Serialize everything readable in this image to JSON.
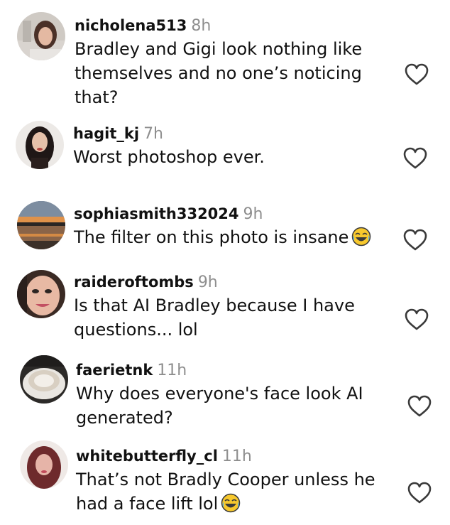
{
  "comments": [
    {
      "username": "nicholena513",
      "time": "8h",
      "lines": [
        "Bradley and Gigi look nothing like",
        "themselves and no one’s noticing",
        "that?"
      ],
      "avatar_icon": "profile-photo-woman-icon",
      "like_icon": "heart-outline-icon"
    },
    {
      "username": "hagit_kj",
      "time": "7h",
      "lines": [
        "Worst photoshop ever."
      ],
      "avatar_icon": "profile-photo-woman-dark-hair-icon",
      "like_icon": "heart-outline-icon"
    },
    {
      "username": "sophiasmith332024",
      "time": "9h",
      "lines": [
        "The filter on this photo is insane"
      ],
      "emoji": "face-with-tears-of-joy-emoji",
      "avatar_icon": "profile-photo-sunset-icon",
      "like_icon": "heart-outline-icon"
    },
    {
      "username": "raideroftombs",
      "time": "9h",
      "lines": [
        "Is that AI Bradley because I have",
        "questions... lol"
      ],
      "avatar_icon": "profile-photo-face-closeup-icon",
      "like_icon": "heart-outline-icon"
    },
    {
      "username": "faerietnk",
      "time": "11h",
      "lines": [
        "Why does everyone's face look AI",
        "generated?"
      ],
      "avatar_icon": "profile-photo-coffee-cup-icon",
      "like_icon": "heart-outline-icon"
    },
    {
      "username": "whitebutterfly_cl",
      "time": "11h",
      "lines": [
        "That’s not Bradly Cooper unless he",
        "had a face lift lol"
      ],
      "emoji": "face-with-tears-of-joy-emoji",
      "avatar_icon": "profile-photo-woman-red-hair-icon",
      "like_icon": "heart-outline-icon"
    }
  ],
  "colors": {
    "username": "#111111",
    "timestamp": "#8e8e8e",
    "heart_stroke": "#3a3a3a",
    "emoji_face": "#f7c82d"
  }
}
